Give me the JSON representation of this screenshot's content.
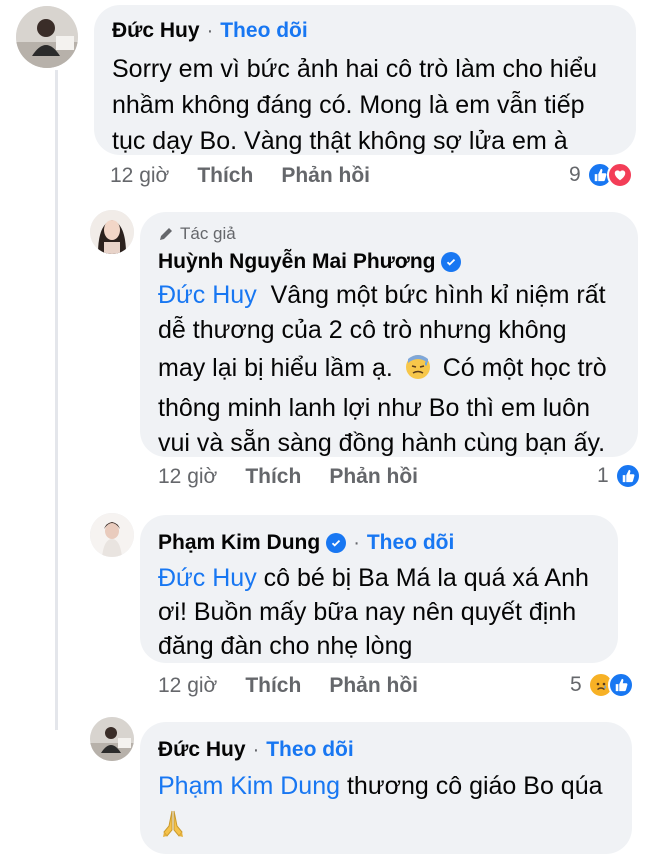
{
  "comments": [
    {
      "author": "Đức Huy",
      "follow": "Theo dõi",
      "lines": [
        "Sorry em vì bức ảnh hai cô trò làm cho  hiểu",
        "nhầm không đáng có. Mong là em vẫn tiếp",
        "tục dạy Bo. Vàng thật không sợ lửa em à"
      ],
      "time": "12 giờ",
      "like": "Thích",
      "reply": "Phản hồi",
      "reactions": "9",
      "reaction_icons": [
        "like-icon",
        "love-icon"
      ]
    },
    {
      "badge": "Tác giả",
      "author": "Huỳnh Nguyễn Mai Phương",
      "mention": "Đức Huy",
      "lines": [
        "Vâng một bức hình kỉ niệm rất",
        "dễ thương của 2 cô trò nhưng không",
        "may lại bị hiểu lầm ạ.",
        "Có một học trò",
        "thông minh lanh lợi như Bo thì em luôn",
        "vui và sẵn sàng đồng hành cùng bạn ấy."
      ],
      "emoji": "downcast-sweat-emoji",
      "time": "12 giờ",
      "like": "Thích",
      "reply": "Phản hồi",
      "reactions": "1",
      "reaction_icons": [
        "like-icon"
      ]
    },
    {
      "author": "Phạm Kim Dung",
      "follow": "Theo dõi",
      "mention": "Đức Huy",
      "lines": [
        "cô bé bị Ba Má la quá xá Anh",
        "ơi! Buồn mấy bữa nay nên quyết định",
        "đăng đàn cho nhẹ lòng"
      ],
      "time": "12 giờ",
      "like": "Thích",
      "reply": "Phản hồi",
      "reactions": "5",
      "reaction_icons": [
        "sad-icon",
        "like-icon"
      ]
    },
    {
      "author": "Đức Huy",
      "follow": "Theo dõi",
      "mention": "Phạm Kim Dung",
      "lines": [
        "thương cô giáo Bo qúa"
      ],
      "emoji": "folded-hands-emoji"
    }
  ],
  "colors": {
    "accent": "#1877f2",
    "bubble": "#f0f2f5",
    "muted": "#65676b"
  }
}
